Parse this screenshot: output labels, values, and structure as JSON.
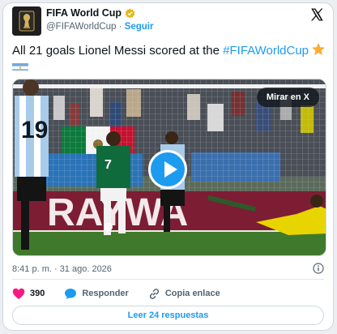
{
  "account": {
    "name": "FIFA World Cup",
    "handle": "@FIFAWorldCup",
    "separator": " · ",
    "follow_label": "Seguir"
  },
  "tweet": {
    "text_before": "All 21 goals Lionel Messi scored at the ",
    "hashtag": "#FIFAWorldCup"
  },
  "media": {
    "watch_label": "Mirar en X",
    "jersey_number": "19",
    "player_number": "7",
    "banner_text": "RAYWA"
  },
  "timestamp": "8:41 p. m. · 31 ago. 2026",
  "actions": {
    "likes": "390",
    "reply_label": "Responder",
    "copy_label": "Copia enlace"
  },
  "read_replies_label": "Leer 24 respuestas",
  "colors": {
    "accent": "#1d9bf0",
    "like": "#f91880",
    "pitch": "#3f7a2c"
  }
}
